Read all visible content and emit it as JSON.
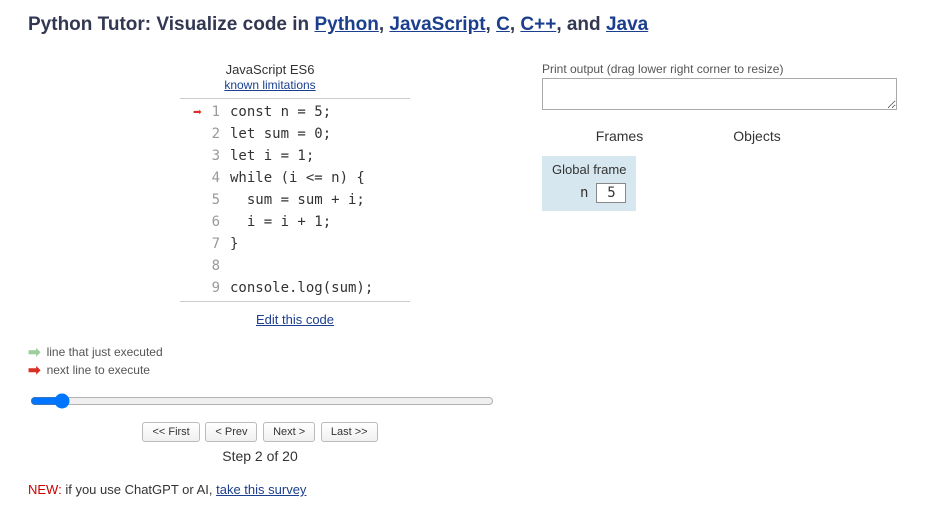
{
  "title": {
    "prefix": "Python Tutor: Visualize code in ",
    "links": [
      "Python",
      "JavaScript",
      "C",
      "C++",
      "Java"
    ],
    "sep": ", ",
    "and": ", and "
  },
  "lang": {
    "name": "JavaScript ES6",
    "limitations_link": "known limitations"
  },
  "code": {
    "lines": [
      "const n = 5;",
      "let sum = 0;",
      "let i = 1;",
      "while (i <= n) {",
      "  sum = sum + i;",
      "  i = i + 1;",
      "}",
      "",
      "console.log(sum);"
    ],
    "next_line_arrow_index": 0
  },
  "edit_link": "Edit this code",
  "legend": {
    "just_executed": "line that just executed",
    "next_to_execute": "next line to execute"
  },
  "nav": {
    "first": "<< First",
    "prev": "< Prev",
    "next": "Next >",
    "last": "Last >>"
  },
  "step_status": "Step 2 of 20",
  "new_notice": {
    "label": "NEW:",
    "text": " if you use ChatGPT or AI, ",
    "link": "take this survey"
  },
  "output": {
    "label": "Print output (drag lower right corner to resize)",
    "value": ""
  },
  "frames_header": {
    "frames": "Frames",
    "objects": "Objects"
  },
  "global_frame": {
    "title": "Global frame",
    "vars": [
      {
        "name": "n",
        "value": "5"
      }
    ]
  }
}
